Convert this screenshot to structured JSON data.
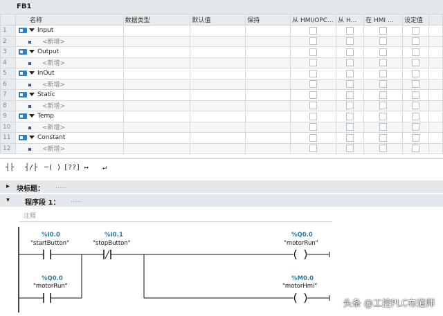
{
  "block": {
    "title": "FB1"
  },
  "interface": {
    "headers": [
      "名称",
      "数据类型",
      "默认值",
      "保持",
      "从 HMI/OPC...",
      "从 H...",
      "在 HMI ...",
      "设定值"
    ],
    "rows": [
      {
        "num": "1",
        "label": "Input",
        "kind": "section"
      },
      {
        "num": "2",
        "label": "<新增>",
        "kind": "new"
      },
      {
        "num": "3",
        "label": "Output",
        "kind": "section"
      },
      {
        "num": "4",
        "label": "<新增>",
        "kind": "new"
      },
      {
        "num": "5",
        "label": "InOut",
        "kind": "section"
      },
      {
        "num": "6",
        "label": "<新增>",
        "kind": "new"
      },
      {
        "num": "7",
        "label": "Static",
        "kind": "section"
      },
      {
        "num": "8",
        "label": "<新增>",
        "kind": "new"
      },
      {
        "num": "9",
        "label": "Temp",
        "kind": "section"
      },
      {
        "num": "10",
        "label": "<新增>",
        "kind": "new"
      },
      {
        "num": "11",
        "label": "Constant",
        "kind": "section"
      },
      {
        "num": "12",
        "label": "<新增>",
        "kind": "new"
      }
    ]
  },
  "toolbar": {
    "items": [
      {
        "name": "no-contact-button",
        "glyph": "┤├"
      },
      {
        "name": "nc-contact-button",
        "glyph": "┤/├"
      },
      {
        "name": "coil-button",
        "glyph": "─( )"
      },
      {
        "name": "empty-box-button",
        "glyph": "[??]"
      },
      {
        "name": "open-branch-button",
        "glyph": "↦"
      },
      {
        "name": "close-branch-button",
        "glyph": "↵"
      }
    ]
  },
  "block_title": {
    "label": "块标题：",
    "value": "....."
  },
  "network": {
    "label": "程序段 1：",
    "value": ".....",
    "comment": "注释"
  },
  "ladder": {
    "contacts": [
      {
        "addr": "%I0.0",
        "tag": "\"startButton\"",
        "type": "NO"
      },
      {
        "addr": "%I0.1",
        "tag": "\"stopButton\"",
        "type": "NC"
      },
      {
        "addr": "%Q0.0",
        "tag": "\"motorRun\"",
        "type": "NO"
      }
    ],
    "coils": [
      {
        "addr": "%Q0.0",
        "tag": "\"motorRun\""
      },
      {
        "addr": "%M0.0",
        "tag": "\"motorHmi\""
      }
    ]
  },
  "watermark": "头条 @工控PLC布道师"
}
